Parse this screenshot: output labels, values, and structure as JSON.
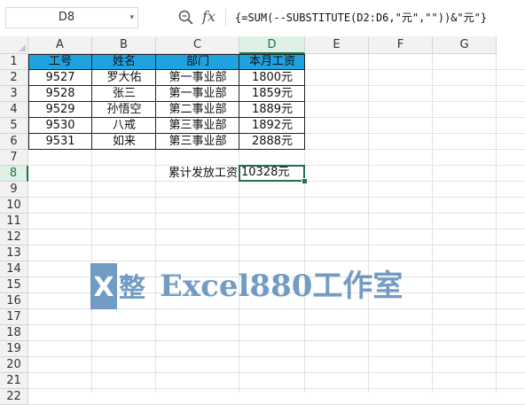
{
  "name_box": {
    "value": "D8"
  },
  "formula_bar": {
    "formula": "{=SUM(--SUBSTITUTE(D2:D6,\"元\",\"\"))&\"元\"}"
  },
  "columns": [
    "A",
    "B",
    "C",
    "D",
    "E",
    "F",
    "G"
  ],
  "rows": [
    "1",
    "2",
    "3",
    "4",
    "5",
    "6",
    "7",
    "8",
    "9",
    "10",
    "11",
    "12",
    "13",
    "14",
    "15",
    "16",
    "17",
    "18",
    "19",
    "20",
    "21",
    "22"
  ],
  "selected": {
    "column": "D",
    "row": "8"
  },
  "table": {
    "header_color": "#1fa2e0",
    "headers": [
      "工号",
      "姓名",
      "部门",
      "本月工资"
    ],
    "rows": [
      [
        "9527",
        "罗大佑",
        "第一事业部",
        "1800元"
      ],
      [
        "9528",
        "张三",
        "第一事业部",
        "1859元"
      ],
      [
        "9529",
        "孙悟空",
        "第二事业部",
        "1889元"
      ],
      [
        "9530",
        "八戒",
        "第三事业部",
        "1892元"
      ],
      [
        "9531",
        "如来",
        "第三事业部",
        "2888元"
      ]
    ]
  },
  "total": {
    "label": "累计发放工资",
    "value": "10328元"
  },
  "watermark": {
    "logo_text": "X",
    "logo_char": "整",
    "text": "Excel880工作室"
  }
}
